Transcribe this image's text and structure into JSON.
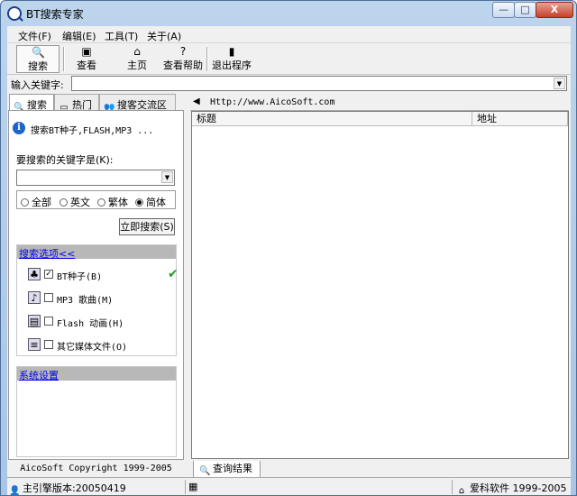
{
  "window": {
    "title": "BT搜索专家",
    "min_glyph": "—",
    "max_glyph": "□",
    "close_glyph": "X"
  },
  "menubar": [
    "文件(F)",
    "编辑(E)",
    "工具(T)",
    "关于(A)"
  ],
  "toolbar": {
    "search": "搜索",
    "view": "查看",
    "home": "主页",
    "help": "查看帮助",
    "exit": "退出程序"
  },
  "keyword_bar": {
    "label": "输入关键字:",
    "value": ""
  },
  "left_tabs": {
    "search": "搜索",
    "hot": "热门",
    "community": "搜客交流区"
  },
  "search_panel": {
    "info": "搜索BT种子,FLASH,MP3 ...",
    "keyword_label": "要搜索的关键字是(K):",
    "radios": [
      {
        "label": "全部",
        "checked": false
      },
      {
        "label": "英文",
        "checked": false
      },
      {
        "label": "繁体",
        "checked": false
      },
      {
        "label": "简体",
        "checked": true
      }
    ],
    "button": "立即搜索(S)",
    "options_title": "搜索选项<<",
    "options": [
      {
        "label": "BT种子(B)",
        "checked": true,
        "icon": "bt-seed-icon"
      },
      {
        "label": "MP3 歌曲(M)",
        "checked": false,
        "icon": "mp3-icon"
      },
      {
        "label": "Flash 动画(H)",
        "checked": false,
        "icon": "flash-icon"
      },
      {
        "label": "其它媒体文件(O)",
        "checked": false,
        "icon": "media-file-icon"
      }
    ],
    "system_title": "系统设置",
    "footer": "AicoSoft Copyright 1999-2005"
  },
  "url_bar": {
    "url": "Http://www.AicoSoft.com"
  },
  "results": {
    "columns": [
      "标题",
      "地址"
    ],
    "tab": "查询结果"
  },
  "statusbar": {
    "left": "主引擎版本:20050419",
    "right": "爱科软件 1999-2005"
  }
}
